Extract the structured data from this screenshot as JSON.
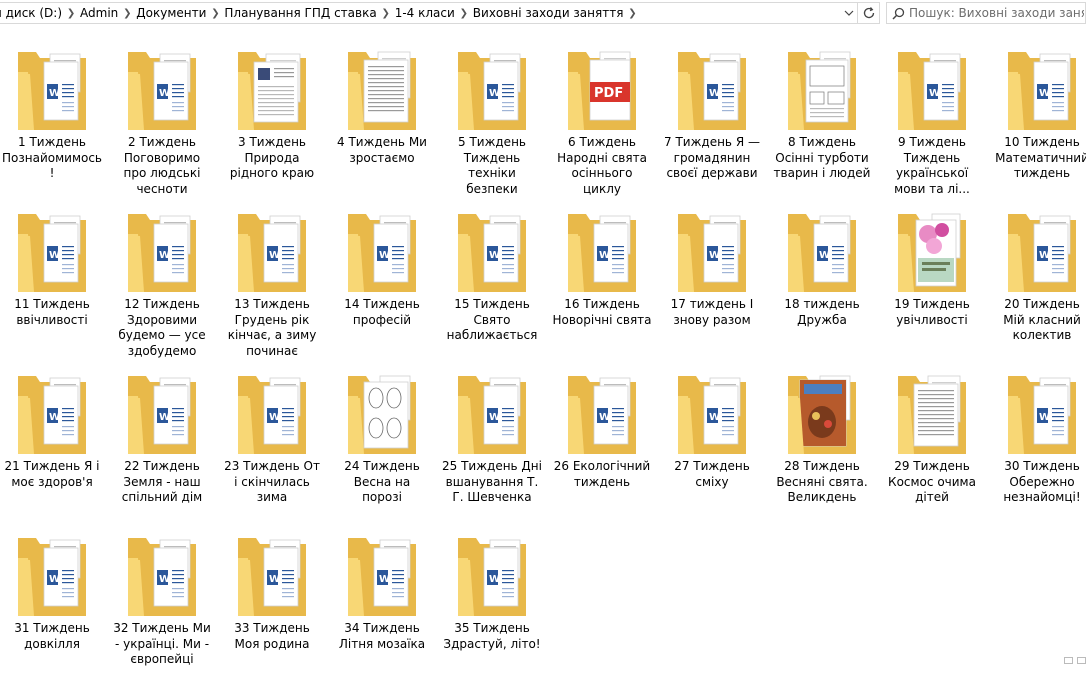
{
  "address_bar": {
    "crumbs": [
      "й диск (D:)",
      "Admin",
      "Документи",
      "Планування ГПД ставка",
      "1-4 класи",
      "Виховні заходи заняття"
    ]
  },
  "search": {
    "placeholder": "Пошук: Виховні заходи заня..."
  },
  "files": [
    {
      "label": "1 Тиждень Познайомимось!",
      "thumb": "word"
    },
    {
      "label": "2 Тиждень Поговоримо про людські чесноти",
      "thumb": "word"
    },
    {
      "label": "3 Тиждень Природа рідного краю",
      "thumb": "doc-photo"
    },
    {
      "label": "4 Тиждень Ми зростаємо",
      "thumb": "doc-text"
    },
    {
      "label": "5 Тиждень Тиждень техніки безпеки",
      "thumb": "word"
    },
    {
      "label": "6 Тиждень Народні свята осіннього циклу",
      "thumb": "pdf"
    },
    {
      "label": "7 Тиждень Я — громадянин своєї держави",
      "thumb": "word"
    },
    {
      "label": "8 Тиждень Осінні турботи тварин і людей",
      "thumb": "doc-sketch"
    },
    {
      "label": "9 Тиждень Тиждень української мови та лі...",
      "thumb": "word"
    },
    {
      "label": "10 Тиждень Математичний тиждень",
      "thumb": "word"
    },
    {
      "label": "11 Тиждень ввічливості",
      "thumb": "word"
    },
    {
      "label": "12 Тиждень Здоровими будемо — усе здобудемо",
      "thumb": "word"
    },
    {
      "label": "13 Тиждень Грудень рік кінчає, а зиму починає",
      "thumb": "word"
    },
    {
      "label": "14 Тиждень професій",
      "thumb": "word"
    },
    {
      "label": "15 Тиждень Свято наближається",
      "thumb": "word"
    },
    {
      "label": "16 Тиждень Новорічні свята",
      "thumb": "word"
    },
    {
      "label": "17 тиждень І знову разом",
      "thumb": "word"
    },
    {
      "label": "18 тиждень Дружба",
      "thumb": "word"
    },
    {
      "label": "19 Тиждень увічливості",
      "thumb": "doc-flowers"
    },
    {
      "label": "20 Тиждень Мій класний колектив",
      "thumb": "word"
    },
    {
      "label": "21 Тиждень Я і моє здоров'я",
      "thumb": "word"
    },
    {
      "label": "22 Тиждень Земля - наш спільний дім",
      "thumb": "word"
    },
    {
      "label": "23 Тиждень От і скінчилась зима",
      "thumb": "word"
    },
    {
      "label": "24 Тиждень Весна на порозі",
      "thumb": "doc-ovals"
    },
    {
      "label": "25 Тиждень Дні вшанування Т. Г. Шевченка",
      "thumb": "word"
    },
    {
      "label": "26 Екологічний тиждень",
      "thumb": "word"
    },
    {
      "label": "27 Тиждень сміху",
      "thumb": "word"
    },
    {
      "label": "28 Тиждень Весняні свята. Великдень",
      "thumb": "doc-easter"
    },
    {
      "label": "29 Тиждень Космос очима дітей",
      "thumb": "doc-text"
    },
    {
      "label": "30 Тиждень Обережно незнайомці!",
      "thumb": "word"
    },
    {
      "label": "31 Тиждень довкілля",
      "thumb": "word"
    },
    {
      "label": "32 Тиждень Ми - українці. Ми - європейці",
      "thumb": "word"
    },
    {
      "label": "33 Тиждень Моя родина",
      "thumb": "word"
    },
    {
      "label": "34 Тиждень Літня мозаїка",
      "thumb": "word"
    },
    {
      "label": "35 Тиждень Здрастуй, літо!",
      "thumb": "word"
    }
  ],
  "pdf_badge": "PDF",
  "colors": {
    "folder_back": "#e8b94a",
    "folder_front": "#f8d775",
    "word_blue": "#2b579a",
    "pdf_red": "#d9352c"
  }
}
